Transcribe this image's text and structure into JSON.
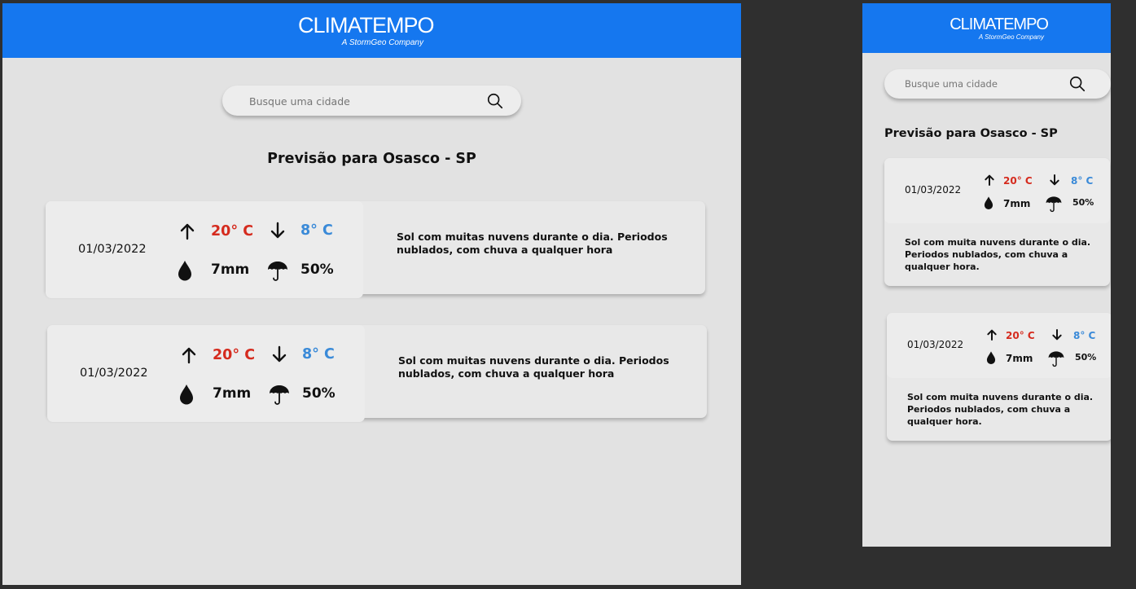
{
  "app": {
    "brand": "CLIMATEMPO",
    "tagline": "A StormGeo Company",
    "header_color": "#1577ef"
  },
  "search": {
    "placeholder": "Busque uma cidade",
    "icon": "search-icon"
  },
  "page_title": "Previsão para Osasco - SP",
  "colors": {
    "max_temp": "#d52b1e",
    "min_temp": "#3a8ad8",
    "background": "#e2e2e2"
  },
  "desktop": {
    "forecasts": [
      {
        "date": "01/03/2022",
        "max_temp": "20° C",
        "min_temp": "8° C",
        "rain": "7mm",
        "rain_probability": "50%",
        "description": "Sol com muitas nuvens durante o dia. Periodos nublados, com chuva a qualquer hora"
      },
      {
        "date": "01/03/2022",
        "max_temp": "20° C",
        "min_temp": "8° C",
        "rain": "7mm",
        "rain_probability": "50%",
        "description": "Sol com muitas nuvens durante o dia. Periodos nublados, com chuva a qualquer hora"
      }
    ]
  },
  "mobile": {
    "forecasts": [
      {
        "date": "01/03/2022",
        "max_temp": "20° C",
        "min_temp": "8° C",
        "rain": "7mm",
        "rain_probability": "50%",
        "description": "Sol com muita nuvens durante o dia. Periodos nublados, com chuva a qualquer hora."
      },
      {
        "date": "01/03/2022",
        "max_temp": "20° C",
        "min_temp": "8° C",
        "rain": "7mm",
        "rain_probability": "50%",
        "description": "Sol com muita nuvens durante o dia. Periodos nublados, com chuva a qualquer hora."
      }
    ]
  }
}
